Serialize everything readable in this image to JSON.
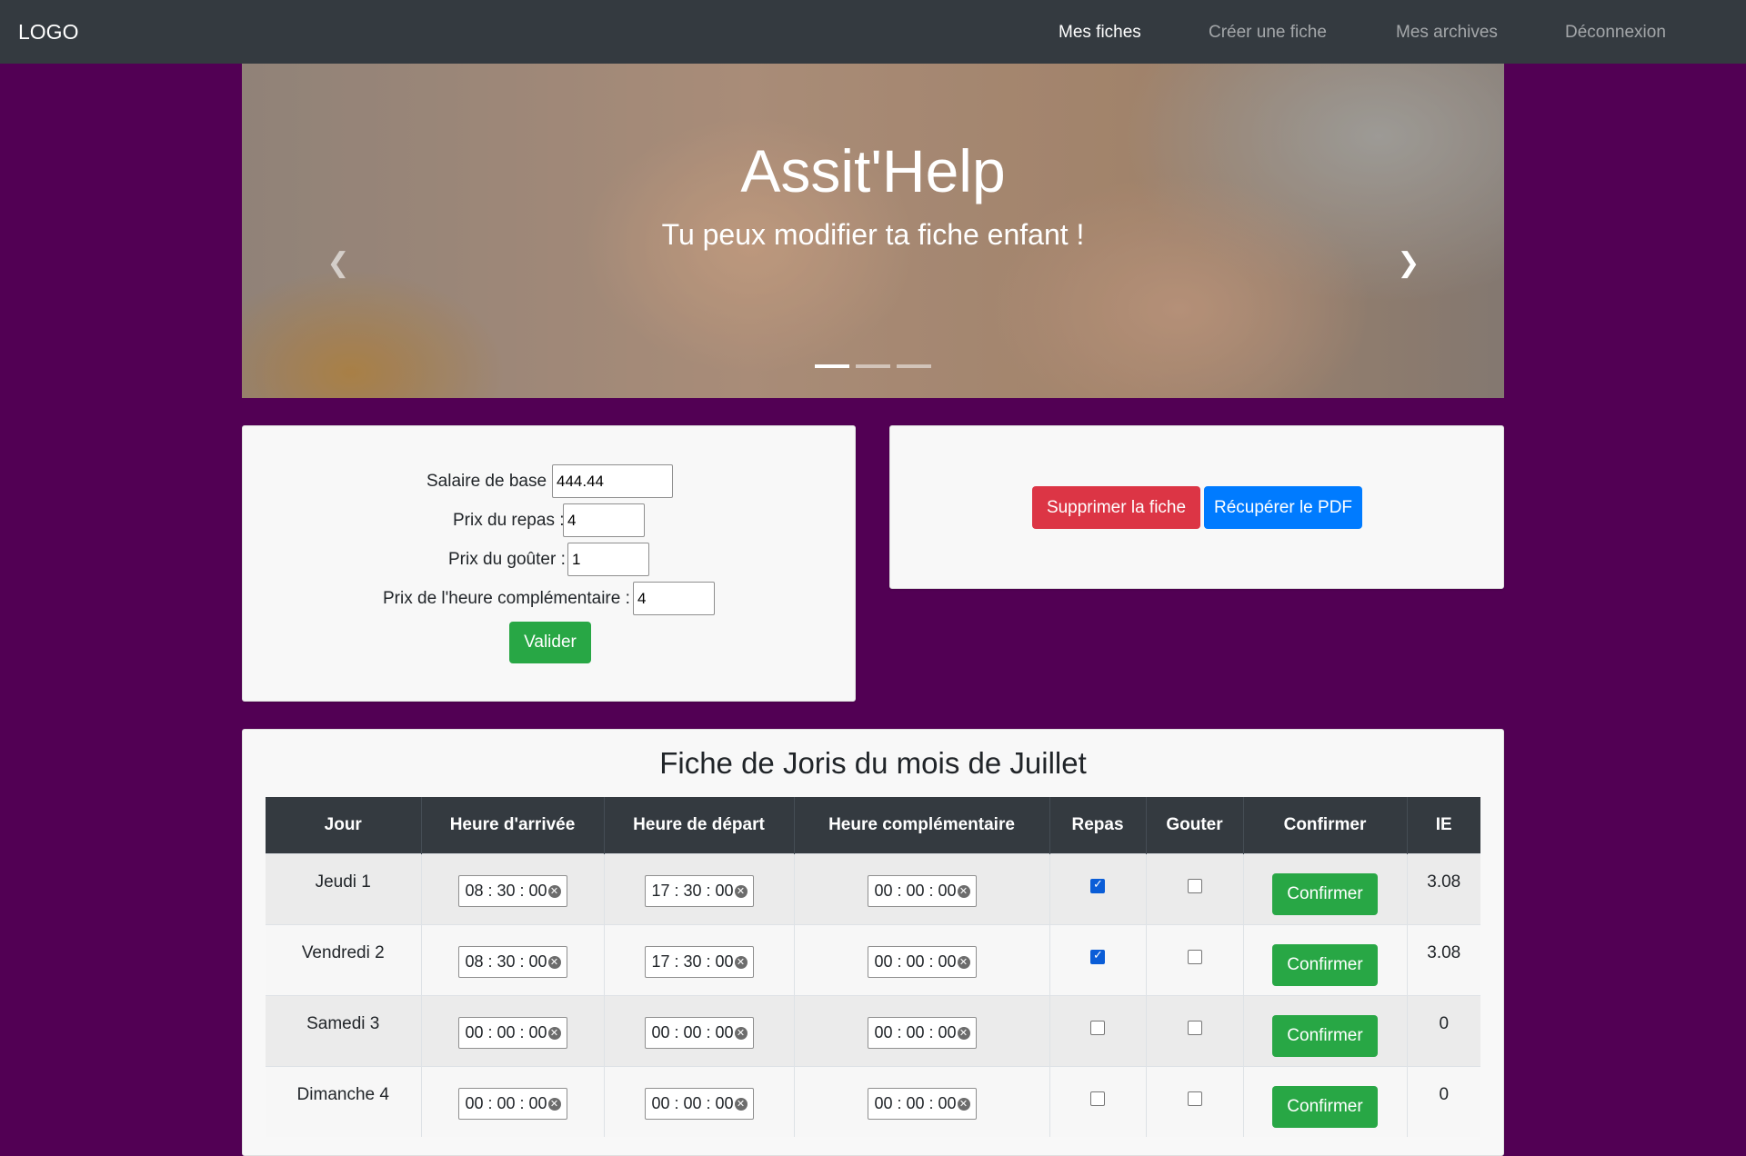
{
  "navbar": {
    "brand": "LOGO",
    "links": [
      {
        "label": "Mes fiches",
        "active": true
      },
      {
        "label": "Créer une fiche",
        "active": false
      },
      {
        "label": "Mes archives",
        "active": false
      },
      {
        "label": "Déconnexion",
        "active": false
      }
    ]
  },
  "carousel": {
    "title": "Assit'Help",
    "subtitle": "Tu peux modifier ta fiche enfant !",
    "prev_icon": "chevron-left-icon",
    "next_icon": "chevron-right-icon",
    "active_slide": 1,
    "slide_count": 3
  },
  "settings_form": {
    "salaire_label": "Salaire de base :",
    "salaire_value": "444.44",
    "repas_label": "Prix du repas :",
    "repas_value": "4",
    "gouter_label": "Prix du goûter :",
    "gouter_value": "1",
    "heure_label": "Prix de l'heure complémentaire :",
    "heure_value": "4",
    "submit_label": "Valider"
  },
  "actions": {
    "delete_label": "Supprimer la fiche",
    "pdf_label": "Récupérer le PDF"
  },
  "sheet": {
    "title": "Fiche de Joris du mois de Juillet",
    "columns": [
      "Jour",
      "Heure d'arrivée",
      "Heure de départ",
      "Heure complémentaire",
      "Repas",
      "Gouter",
      "Confirmer",
      "IE"
    ],
    "rows": [
      {
        "jour": "Jeudi 1",
        "arrivee": "08 : 30 : 00",
        "depart": "17 : 30 : 00",
        "complementaire": "00 : 00 : 00",
        "repas": true,
        "gouter": false,
        "confirm_label": "Confirmer",
        "ie": "3.08"
      },
      {
        "jour": "Vendredi 2",
        "arrivee": "08 : 30 : 00",
        "depart": "17 : 30 : 00",
        "complementaire": "00 : 00 : 00",
        "repas": true,
        "gouter": false,
        "confirm_label": "Confirmer",
        "ie": "3.08"
      },
      {
        "jour": "Samedi 3",
        "arrivee": "00 : 00 : 00",
        "depart": "00 : 00 : 00",
        "complementaire": "00 : 00 : 00",
        "repas": false,
        "gouter": false,
        "confirm_label": "Confirmer",
        "ie": "0"
      },
      {
        "jour": "Dimanche 4",
        "arrivee": "00 : 00 : 00",
        "depart": "00 : 00 : 00",
        "complementaire": "00 : 00 : 00",
        "repas": false,
        "gouter": false,
        "confirm_label": "Confirmer",
        "ie": "0"
      }
    ]
  },
  "colors": {
    "page_bg": "#520054",
    "navbar_bg": "#343a40",
    "success": "#28a745",
    "danger": "#dc3545",
    "primary": "#007bff"
  }
}
